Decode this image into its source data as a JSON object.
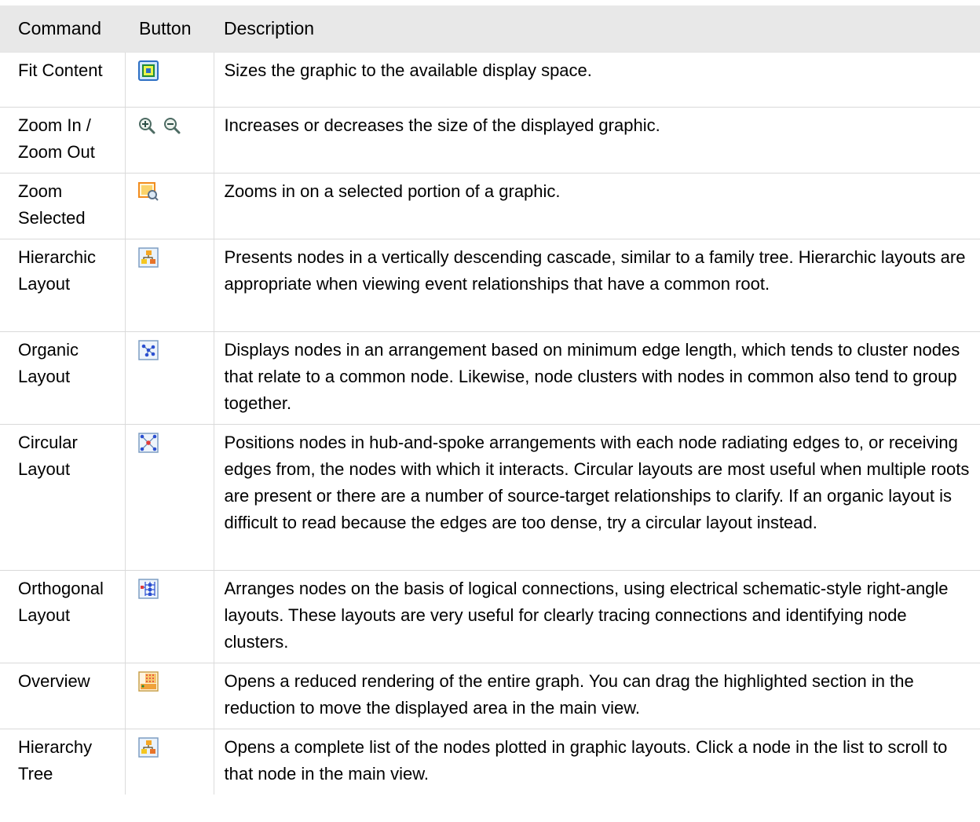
{
  "table": {
    "headers": {
      "command": "Command",
      "button": "Button",
      "description": "Description"
    },
    "rows": [
      {
        "command": "Fit Content",
        "icons": [
          "fit-content-icon"
        ],
        "description": "Sizes the graphic to the available display space."
      },
      {
        "command": "Zoom In / Zoom Out",
        "icons": [
          "zoom-in-icon",
          "zoom-out-icon"
        ],
        "description": "Increases or decreases the size of the displayed graphic."
      },
      {
        "command": "Zoom Selected",
        "icons": [
          "zoom-selected-icon"
        ],
        "description": "Zooms in on a selected portion of a graphic."
      },
      {
        "command": "Hierarchic Layout",
        "icons": [
          "hierarchic-layout-icon"
        ],
        "description": "Presents nodes in a vertically descending cascade, similar to a family tree. Hierarchic layouts are appropriate when viewing event relationships that have a common root."
      },
      {
        "command": "Organic Layout",
        "icons": [
          "organic-layout-icon"
        ],
        "description": "Displays nodes in an arrangement based on minimum edge length, which tends to cluster nodes that relate to a common node. Likewise, node clusters with nodes in common also tend to group together."
      },
      {
        "command": "Circular Layout",
        "icons": [
          "circular-layout-icon"
        ],
        "description": "Positions nodes in hub-and-spoke arrangements with each node radiating edges to, or receiving edges from, the nodes with which it interacts. Circular layouts are most useful when multiple roots are present or there are a number of source-target relationships to clarify. If an organic layout is difficult to read because the edges are too dense, try a circular layout instead."
      },
      {
        "command": "Orthogonal Layout",
        "icons": [
          "orthogonal-layout-icon"
        ],
        "description": "Arranges nodes on the basis of logical connections, using electrical schematic-style right-angle layouts. These layouts are very useful for clearly tracing connections and identifying node clusters."
      },
      {
        "command": "Overview",
        "icons": [
          "overview-icon"
        ],
        "description": "Opens a reduced rendering of the entire graph. You can drag the highlighted section in the reduction to move the displayed area in the main view."
      },
      {
        "command": "Hierarchy Tree",
        "icons": [
          "hierarchy-tree-icon"
        ],
        "description": "Opens a complete list of the nodes plotted in graphic layouts. Click a node in the list to scroll to that node in the main view."
      }
    ]
  }
}
